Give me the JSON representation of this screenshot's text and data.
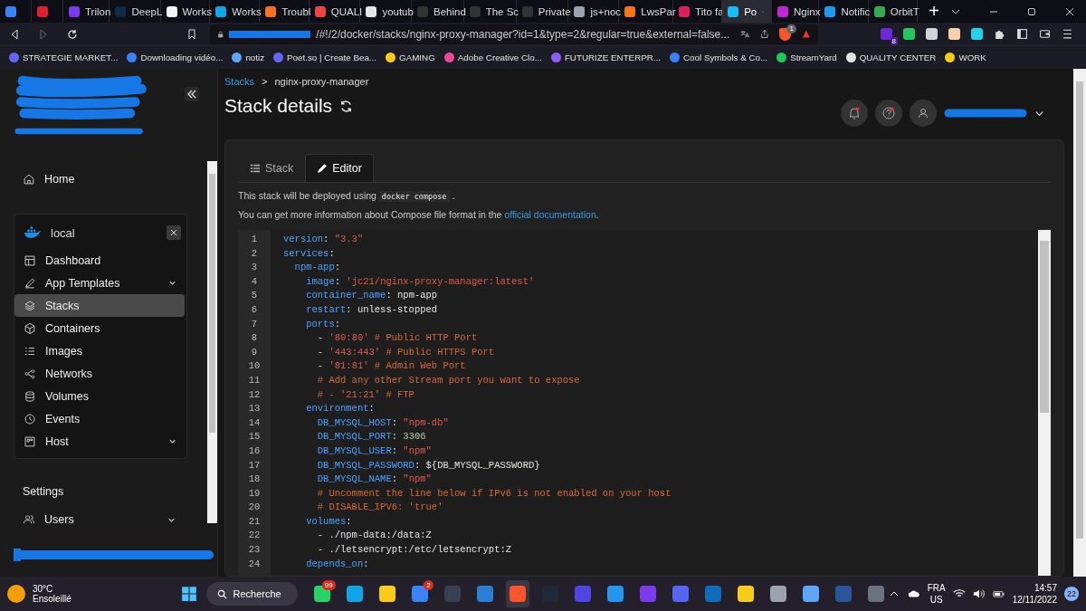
{
  "browser": {
    "tabs": [
      {
        "color": "#3b82f6",
        "selected": false
      },
      {
        "color": "#e11d2e",
        "selected": false
      },
      {
        "label": "Trilon",
        "color": "#7c3aed",
        "selected": false
      },
      {
        "label": "DeepL",
        "color": "#0f2b46",
        "selected": false
      },
      {
        "label": "Works",
        "color": "#f5f5f5",
        "selected": false
      },
      {
        "label": "Works",
        "color": "#0ea5e9",
        "selected": false
      },
      {
        "label": "Troubl",
        "color": "#f97316",
        "selected": false
      },
      {
        "label": "QUALI",
        "color": "#ef4444",
        "selected": false
      },
      {
        "label": "youtub",
        "color": "#e5e5e5",
        "selected": false
      },
      {
        "label": "Behind",
        "color": "#333333",
        "selected": false
      },
      {
        "label": "The Sc",
        "color": "#333333",
        "selected": false
      },
      {
        "label": "Private",
        "color": "#333333",
        "selected": false
      },
      {
        "label": "js+noc",
        "color": "#9ca3af",
        "selected": false
      },
      {
        "label": "LwsPar",
        "color": "#f97316",
        "selected": false
      },
      {
        "label": "Tito fa",
        "color": "#e01e5a",
        "selected": false
      },
      {
        "label": "Po",
        "color": "#13bef9",
        "selected": true
      },
      {
        "label": "Nginx",
        "color": "#c026d3",
        "selected": false
      },
      {
        "label": "Notific",
        "color": "#1d9bf0",
        "selected": false
      },
      {
        "label": "OrbitT",
        "color": "#34a853",
        "selected": false
      }
    ],
    "new_tab": "+",
    "url": "/#!/2/docker/stacks/nginx-proxy-manager?id=1&type=2&regular=true&external=false...",
    "shield_badge": "1",
    "extensions": [
      {
        "color": "#6d28d9",
        "badge": "8"
      },
      {
        "color": "#22c55e"
      },
      {
        "color": "#d4d4d4"
      },
      {
        "color": "#f5d0a9"
      },
      {
        "color": "#22d3ee"
      }
    ],
    "bookmarks": [
      {
        "label": "STRATEGIE MARKET...",
        "color": "#6366f1"
      },
      {
        "label": "Downloading vidéo...",
        "color": "#3b82f6"
      },
      {
        "label": "notiz",
        "color": "#60a5fa"
      },
      {
        "label": "Poet.so | Create Bea...",
        "color": "#6366f1"
      },
      {
        "label": "GAMING",
        "color": "#facc15"
      },
      {
        "label": "Adobe Creative Clo...",
        "color": "#ec4899"
      },
      {
        "label": "FUTURIZE ENTERPR...",
        "color": "#8b5cf6"
      },
      {
        "label": "Cool Symbols & Co...",
        "color": "#3b82f6"
      },
      {
        "label": "StreamYard",
        "color": "#22c55e"
      },
      {
        "label": "QUALITY CENTER",
        "color": "#e5e5e5"
      },
      {
        "label": "WORK",
        "color": "#facc15"
      }
    ]
  },
  "sidebar": {
    "home": "Home",
    "environment": {
      "name": "local",
      "items": [
        {
          "label": "Dashboard",
          "kind": "link",
          "selected": false
        },
        {
          "label": "App Templates",
          "kind": "group",
          "selected": false
        },
        {
          "label": "Stacks",
          "kind": "link",
          "selected": true
        },
        {
          "label": "Containers",
          "kind": "link",
          "selected": false
        },
        {
          "label": "Images",
          "kind": "link",
          "selected": false
        },
        {
          "label": "Networks",
          "kind": "link",
          "selected": false
        },
        {
          "label": "Volumes",
          "kind": "link",
          "selected": false
        },
        {
          "label": "Events",
          "kind": "link",
          "selected": false
        },
        {
          "label": "Host",
          "kind": "group",
          "selected": false
        }
      ]
    },
    "settings_heading": "Settings",
    "settings_items": [
      {
        "label": "Users",
        "kind": "group",
        "selected": false
      }
    ]
  },
  "breadcrumb": {
    "link": "Stacks",
    "separator": ">",
    "current": "nginx-proxy-manager"
  },
  "title": "Stack details",
  "tabs": [
    {
      "label": "Stack",
      "selected": false
    },
    {
      "label": "Editor",
      "selected": true
    }
  ],
  "info": {
    "line1_before": "This stack will be deployed using",
    "line1_code": "docker compose",
    "line1_after": ".",
    "line2_before": "You can get more information about Compose file format in the",
    "line2_link": "official documentation",
    "line2_after": "."
  },
  "editor": {
    "lines": [
      {
        "number": "1",
        "tokens": [
          {
            "kind": "key",
            "t": "version"
          },
          {
            "kind": "plain",
            "t": ": "
          },
          {
            "kind": "string",
            "t": "\"3.3\""
          }
        ]
      },
      {
        "number": "2",
        "tokens": [
          {
            "kind": "key",
            "t": "services"
          },
          {
            "kind": "plain",
            "t": ":"
          }
        ]
      },
      {
        "number": "3",
        "tokens": [
          {
            "kind": "key",
            "t": "  npm-app"
          },
          {
            "kind": "plain",
            "t": ":"
          }
        ]
      },
      {
        "number": "4",
        "tokens": [
          {
            "kind": "key",
            "t": "    image"
          },
          {
            "kind": "plain",
            "t": ": "
          },
          {
            "kind": "string",
            "t": "'jc21/nginx-proxy-manager:latest'"
          }
        ]
      },
      {
        "number": "5",
        "tokens": [
          {
            "kind": "key",
            "t": "    container_name"
          },
          {
            "kind": "plain",
            "t": ": npm-app"
          }
        ]
      },
      {
        "number": "6",
        "tokens": [
          {
            "kind": "key",
            "t": "    restart"
          },
          {
            "kind": "plain",
            "t": ": unless-stopped"
          }
        ]
      },
      {
        "number": "7",
        "tokens": [
          {
            "kind": "key",
            "t": "    ports"
          },
          {
            "kind": "plain",
            "t": ":"
          }
        ]
      },
      {
        "number": "8",
        "tokens": [
          {
            "kind": "plain",
            "t": "      - "
          },
          {
            "kind": "string",
            "t": "'80:80'"
          },
          {
            "kind": "comment",
            "t": " # Public HTTP Port"
          }
        ]
      },
      {
        "number": "9",
        "tokens": [
          {
            "kind": "plain",
            "t": "      - "
          },
          {
            "kind": "string",
            "t": "'443:443'"
          },
          {
            "kind": "comment",
            "t": " # Public HTTPS Port"
          }
        ]
      },
      {
        "number": "10",
        "tokens": [
          {
            "kind": "plain",
            "t": "      - "
          },
          {
            "kind": "string",
            "t": "'81:81'"
          },
          {
            "kind": "comment",
            "t": " # Admin Web Port"
          }
        ]
      },
      {
        "number": "11",
        "tokens": [
          {
            "kind": "comment",
            "t": "      # Add any other Stream port you want to expose"
          }
        ]
      },
      {
        "number": "12",
        "tokens": [
          {
            "kind": "comment",
            "t": "      # - '21:21' # FTP"
          }
        ]
      },
      {
        "number": "13",
        "tokens": [
          {
            "kind": "key",
            "t": "    environment"
          },
          {
            "kind": "plain",
            "t": ":"
          }
        ]
      },
      {
        "number": "14",
        "tokens": [
          {
            "kind": "key",
            "t": "      DB_MYSQL_HOST"
          },
          {
            "kind": "plain",
            "t": ": "
          },
          {
            "kind": "string",
            "t": "\"npm-db\""
          }
        ]
      },
      {
        "number": "15",
        "tokens": [
          {
            "kind": "key",
            "t": "      DB_MYSQL_PORT"
          },
          {
            "kind": "plain",
            "t": ": "
          },
          {
            "kind": "number",
            "t": "3306"
          }
        ]
      },
      {
        "number": "16",
        "tokens": [
          {
            "kind": "key",
            "t": "      DB_MYSQL_USER"
          },
          {
            "kind": "plain",
            "t": ": "
          },
          {
            "kind": "string",
            "t": "\"npm\""
          }
        ]
      },
      {
        "number": "17",
        "tokens": [
          {
            "kind": "key",
            "t": "      DB_MYSQL_PASSWORD"
          },
          {
            "kind": "plain",
            "t": ": ${DB_MYSQL_PASSWORD}"
          }
        ]
      },
      {
        "number": "18",
        "tokens": [
          {
            "kind": "key",
            "t": "      DB_MYSQL_NAME"
          },
          {
            "kind": "plain",
            "t": ": "
          },
          {
            "kind": "string",
            "t": "\"npm\""
          }
        ]
      },
      {
        "number": "19",
        "tokens": [
          {
            "kind": "comment",
            "t": "      # Uncomment the line below if IPv6 is not enabled on your host"
          }
        ]
      },
      {
        "number": "20",
        "tokens": [
          {
            "kind": "comment",
            "t": "      # DISABLE_IPV6: 'true'"
          }
        ]
      },
      {
        "number": "21",
        "tokens": [
          {
            "kind": "key",
            "t": "    volumes"
          },
          {
            "kind": "plain",
            "t": ":"
          }
        ]
      },
      {
        "number": "22",
        "tokens": [
          {
            "kind": "plain",
            "t": "      - ./npm-data:/data:Z"
          }
        ]
      },
      {
        "number": "23",
        "tokens": [
          {
            "kind": "plain",
            "t": "      - ./letsencrypt:/etc/letsencrypt:Z"
          }
        ]
      },
      {
        "number": "24",
        "tokens": [
          {
            "kind": "key",
            "t": "    depends_on"
          },
          {
            "kind": "plain",
            "t": ":"
          }
        ]
      }
    ]
  },
  "taskbar": {
    "weather": {
      "temperature": "30°C",
      "condition": "Ensoleillé"
    },
    "search": "Recherche",
    "apps": [
      {
        "color": "#25d366",
        "badge": "99",
        "selected": false
      },
      {
        "color": "#0ea5e9",
        "selected": false
      },
      {
        "color": "#facc15",
        "selected": false
      },
      {
        "color": "#3b82f6",
        "badge": "2",
        "selected": false
      },
      {
        "color": "#374151",
        "selected": false
      },
      {
        "color": "#2b7fd6",
        "selected": false
      },
      {
        "color": "#fb542b",
        "selected": true
      },
      {
        "color": "#1f2937",
        "selected": false
      },
      {
        "color": "#4f46e5",
        "selected": false
      },
      {
        "color": "#2496ed",
        "selected": false
      },
      {
        "color": "#7c3aed",
        "selected": false
      },
      {
        "color": "#5865f2",
        "selected": false
      },
      {
        "color": "#0f6cbd",
        "selected": false
      },
      {
        "color": "#facc15",
        "selected": false
      },
      {
        "color": "#9ca3af",
        "selected": false
      },
      {
        "color": "#60a5fa",
        "selected": false
      },
      {
        "color": "#2b579a",
        "selected": false
      },
      {
        "color": "#6b7280",
        "selected": false
      }
    ],
    "language": "FRA",
    "layout": "US",
    "time": "14:57",
    "date": "12/11/2022",
    "notifications": "22"
  }
}
